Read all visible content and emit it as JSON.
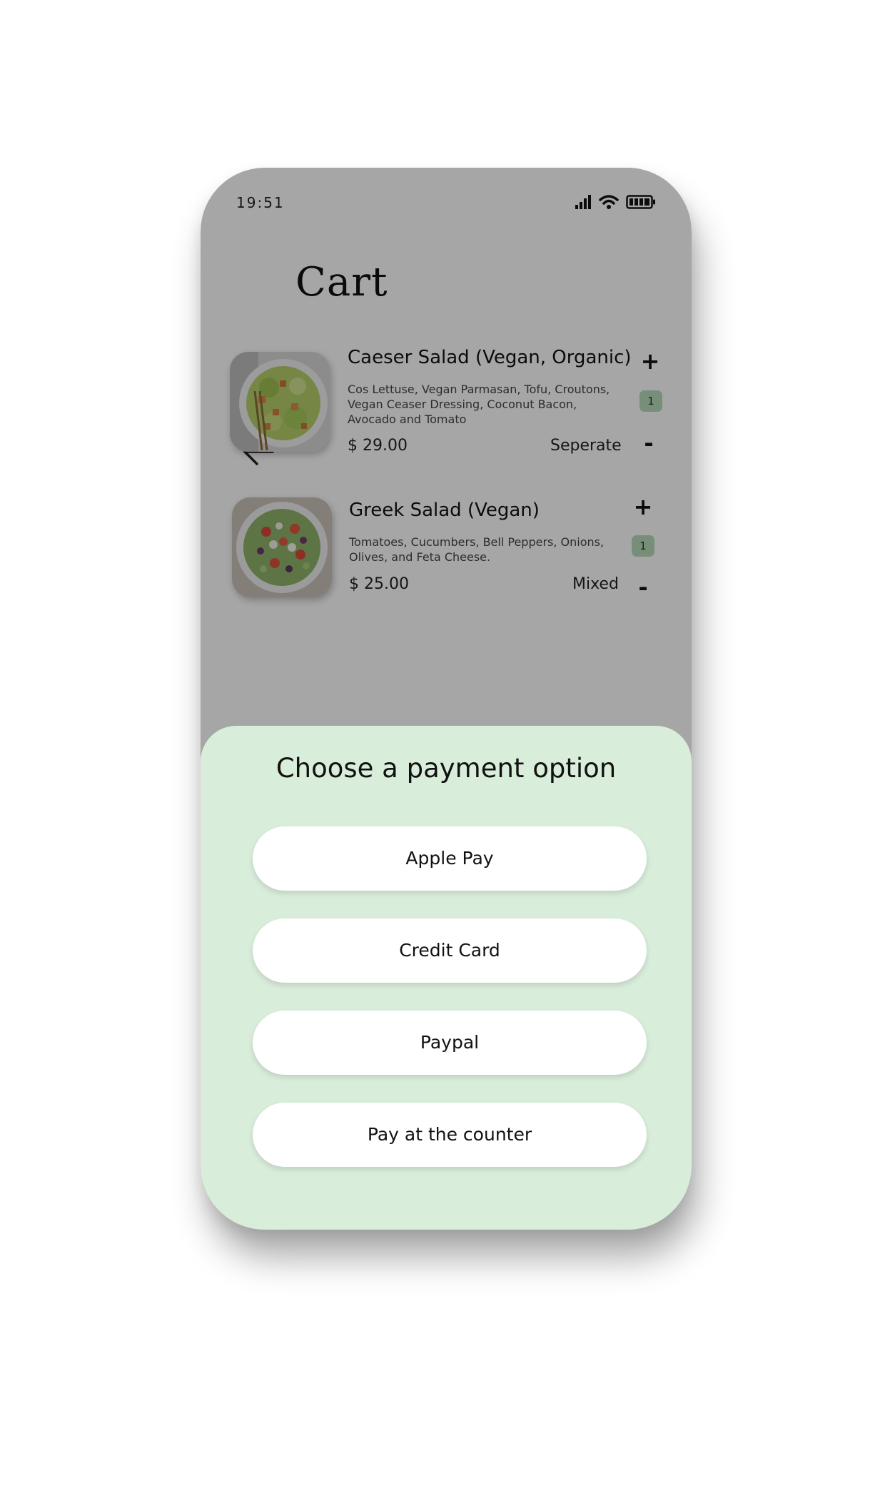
{
  "status_bar": {
    "time": "19:51",
    "icons": [
      "signal-icon",
      "wifi-icon",
      "battery-icon"
    ]
  },
  "header": {
    "back_icon": "arrow-left-icon",
    "title": "Cart"
  },
  "cart": {
    "items": [
      {
        "name": "Caeser Salad (Vegan, Organic)",
        "description": "Cos Lettuse, Vegan Parmasan, Tofu, Croutons, Vegan Ceaser Dressing, Coconut Bacon, Avocado and Tomato",
        "price": "$ 29.00",
        "option": "Seperate",
        "quantity": "1",
        "plus": "+",
        "minus": "-"
      },
      {
        "name": "Greek Salad (Vegan)",
        "description": "Tomatoes, Cucumbers, Bell Peppers, Onions, Olives, and Feta Cheese.",
        "price": "$ 25.00",
        "option": "Mixed",
        "quantity": "1",
        "plus": "+",
        "minus": "-"
      }
    ]
  },
  "payment_sheet": {
    "title": "Choose a payment option",
    "options": [
      "Apple Pay",
      "Credit Card",
      "Paypal",
      "Pay at the counter"
    ]
  },
  "colors": {
    "sheet_background": "#d9eddb",
    "quantity_badge": "#b7dbb9",
    "overlay": "rgba(0,0,0,0.35)"
  }
}
